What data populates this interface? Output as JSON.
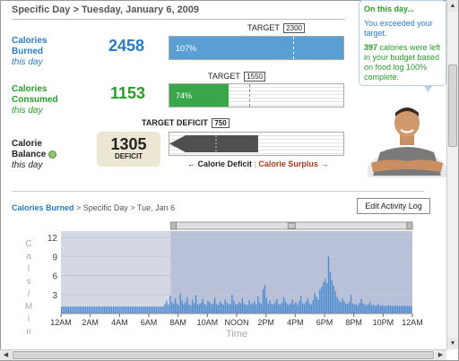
{
  "header": {
    "section": "Specific Day",
    "sep": ">",
    "date": "Tuesday, January 6, 2009"
  },
  "burned": {
    "l1": "Calories",
    "l2": "Burned",
    "l3": "this day",
    "value": "2458",
    "target_label": "TARGET",
    "target_value": "2300",
    "pct": "107%",
    "fill_fraction": 1.0,
    "target_fraction": 0.71,
    "color": "#5a9fd4"
  },
  "consumed": {
    "l1": "Calories",
    "l2": "Consumed",
    "l3": "this day",
    "value": "1153",
    "target_label": "TARGET",
    "target_value": "1550",
    "pct": "74%",
    "fill_fraction": 0.34,
    "target_fraction": 0.46,
    "color": "#3aa64a"
  },
  "balance": {
    "l1": "Calorie",
    "l2": "Balance",
    "l3": "this day",
    "value": "1305",
    "deficit_label": "DEFICIT",
    "target_label": "TARGET DEFICIT",
    "target_value": "750",
    "deficit_text": "Calorie Deficit",
    "surplus_text": "Calorie Surplus",
    "fill_fraction": 0.51,
    "color": "#505050"
  },
  "tooltip": {
    "title": "On this day...",
    "msg": "You exceeded your target.",
    "num": "397",
    "rest": "calories were left in your budget based on food log 100% complete."
  },
  "activity": {
    "crumb_link": "Calories Burned",
    "crumb_rest": "> Specific Day > Tue, Jan 6",
    "edit_button": "Edit Activity Log"
  },
  "chart_data": {
    "type": "bar",
    "ylabel": "Cals / Min",
    "xlabel": "Time",
    "ylim": [
      0,
      13
    ],
    "yticks": [
      3,
      6,
      9,
      12
    ],
    "xticks": [
      "12AM",
      "2AM",
      "4AM",
      "6AM",
      "8AM",
      "10AM",
      "NOON",
      "2PM",
      "4PM",
      "6PM",
      "8PM",
      "10PM",
      "12AM"
    ],
    "selection_start_hour": 7.5,
    "baseline": 1.1,
    "values": [
      1.1,
      1.1,
      1.1,
      1.1,
      1.1,
      1.1,
      1.1,
      1.1,
      1.1,
      1.1,
      1.1,
      1.1,
      1.1,
      1.1,
      1.1,
      1.1,
      1.1,
      1.1,
      1.1,
      1.1,
      1.1,
      1.1,
      1.1,
      1.1,
      1.1,
      1.1,
      1.1,
      1.1,
      1.1,
      1.1,
      1.1,
      1.1,
      1.1,
      1.1,
      1.1,
      1.1,
      1.1,
      1.1,
      1.1,
      1.1,
      1.1,
      1.1,
      1.1,
      1.1,
      1.1,
      1.1,
      1.1,
      1.1,
      1.1,
      1.1,
      1.1,
      1.1,
      1.1,
      1.1,
      1.1,
      1.1,
      1.1,
      1.1,
      1.1,
      1.1,
      1.5,
      2.0,
      1.4,
      2.8,
      1.8,
      1.5,
      2.4,
      1.6,
      1.3,
      3.2,
      2.1,
      1.5,
      1.8,
      2.6,
      1.4,
      1.3,
      2.2,
      1.6,
      2.9,
      1.5,
      1.4,
      1.7,
      2.3,
      1.5,
      1.3,
      2.0,
      1.8,
      1.4,
      1.6,
      2.5,
      1.5,
      1.3,
      1.9,
      1.6,
      1.4,
      2.2,
      1.7,
      1.4,
      1.5,
      3.0,
      2.0,
      1.5,
      1.4,
      1.8,
      1.6,
      2.4,
      1.5,
      1.4,
      1.3,
      2.1,
      1.5,
      1.6,
      1.9,
      1.4,
      2.7,
      1.8,
      1.5,
      3.8,
      4.5,
      2.5,
      1.6,
      2.1,
      1.5,
      1.4,
      1.8,
      2.3,
      1.5,
      1.4,
      1.7,
      2.6,
      1.9,
      1.5,
      1.4,
      1.6,
      2.2,
      1.5,
      1.8,
      1.4,
      2.0,
      2.8,
      1.6,
      1.5,
      1.9,
      2.4,
      1.6,
      1.4,
      2.1,
      3.2,
      2.6,
      2.2,
      3.8,
      4.2,
      5.0,
      5.5,
      4.8,
      9.0,
      6.5,
      5.2,
      4.4,
      3.5,
      2.6,
      2.1,
      1.8,
      2.4,
      1.9,
      1.6,
      1.5,
      1.8,
      3.0,
      1.6,
      1.4,
      1.5,
      1.3,
      1.7,
      2.3,
      1.6,
      1.4,
      1.3,
      1.5,
      1.8,
      1.3,
      1.4,
      1.2,
      1.3,
      1.5,
      1.2,
      1.3,
      1.2,
      1.2,
      1.2,
      1.3,
      1.2,
      1.2,
      1.2,
      1.2,
      1.2,
      1.2,
      1.2,
      1.2,
      1.2,
      1.2,
      1.2,
      1.2,
      1.2
    ]
  }
}
